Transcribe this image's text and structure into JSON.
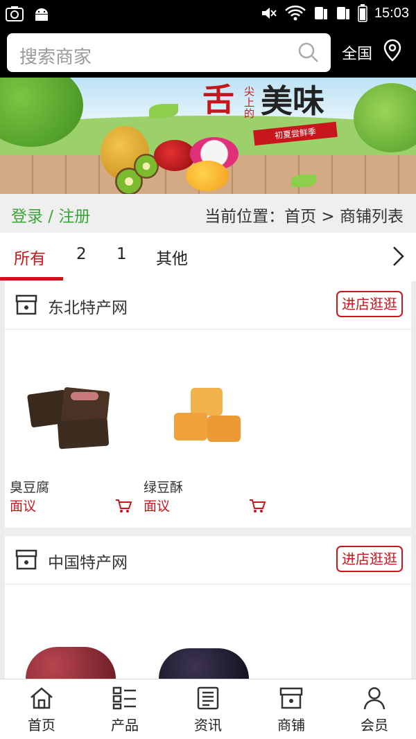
{
  "status_bar": {
    "time": "15:03"
  },
  "search": {
    "placeholder": "搜索商家",
    "region_label": "全国"
  },
  "banner": {
    "title_char": "舌",
    "small_text": "尖上的",
    "title_rest": "美味",
    "ribbon": "初夏尝鲜季"
  },
  "location": {
    "login_label": "登录 / 注册",
    "breadcrumb": "当前位置：首页 > 商铺列表"
  },
  "tabs": [
    {
      "label": "所有",
      "active": true
    },
    {
      "label": "2"
    },
    {
      "label": "1"
    },
    {
      "label": "其他"
    }
  ],
  "stores": [
    {
      "name": "东北特产网",
      "visit_label": "进店逛逛",
      "products": [
        {
          "name": "臭豆腐",
          "price": "面议"
        },
        {
          "name": "绿豆酥",
          "price": "面议"
        }
      ]
    },
    {
      "name": "中国特产网",
      "visit_label": "进店逛逛",
      "products": []
    }
  ],
  "bottom_nav": [
    {
      "label": "首页",
      "icon": "home-icon"
    },
    {
      "label": "产品",
      "icon": "grid-list-icon"
    },
    {
      "label": "资讯",
      "icon": "news-icon"
    },
    {
      "label": "商铺",
      "icon": "store-icon"
    },
    {
      "label": "会员",
      "icon": "user-icon"
    }
  ],
  "colors": {
    "accent": "#c8161d",
    "login": "#3aa63a",
    "header": "#000000"
  }
}
